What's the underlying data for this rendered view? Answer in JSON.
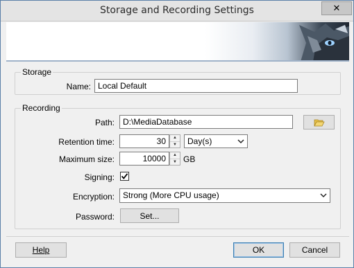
{
  "window": {
    "title": "Storage and Recording Settings",
    "close_glyph": "✕"
  },
  "storage": {
    "group_title": "Storage",
    "name_label": "Name:",
    "name_value": "Local Default"
  },
  "recording": {
    "group_title": "Recording",
    "path_label": "Path:",
    "path_value": "D:\\MediaDatabase",
    "retention_label": "Retention time:",
    "retention_value": "30",
    "retention_unit": "Day(s)",
    "max_size_label": "Maximum size:",
    "max_size_value": "10000",
    "max_size_unit": "GB",
    "signing_label": "Signing:",
    "signing_checked": true,
    "encryption_label": "Encryption:",
    "encryption_value": "Strong (More CPU usage)",
    "password_label": "Password:",
    "password_button": "Set..."
  },
  "footer": {
    "help": "Help",
    "ok": "OK",
    "cancel": "Cancel"
  },
  "icons": {
    "browse": "folder-open-icon",
    "spin_up": "▲",
    "spin_down": "▼",
    "dropdown": "chevron-down-icon"
  }
}
